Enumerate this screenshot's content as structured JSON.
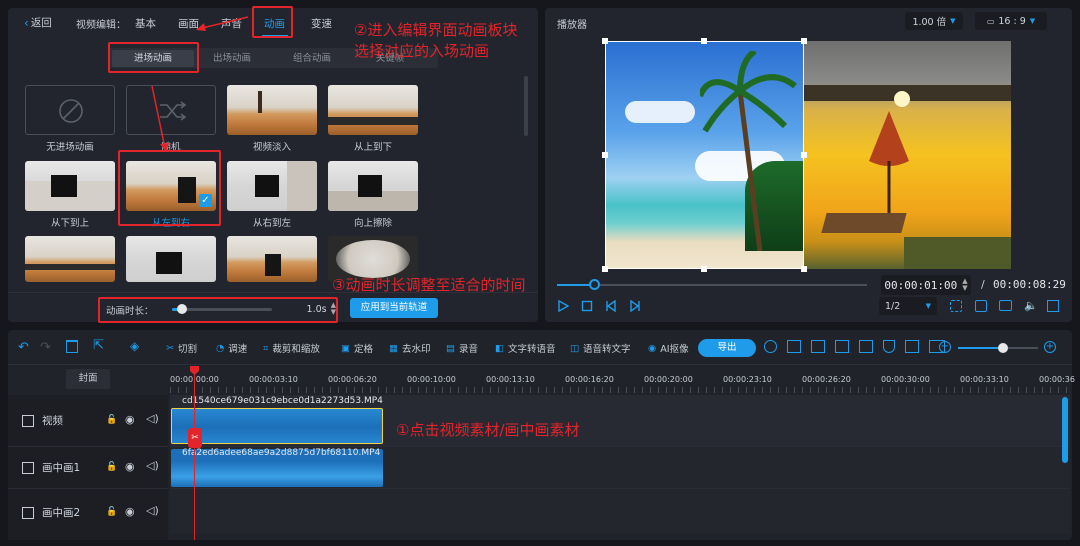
{
  "editor": {
    "back_label": "返回",
    "title_label": "视频编辑：",
    "tabs": [
      "基本",
      "画面",
      "声音",
      "动画",
      "变速"
    ],
    "subtabs": [
      "进场动画",
      "出场动画",
      "组合动画",
      "关键帧"
    ],
    "animations": [
      {
        "label": "无进场动画"
      },
      {
        "label": "随机"
      },
      {
        "label": "视频淡入"
      },
      {
        "label": "从上到下"
      },
      {
        "label": "从下到上"
      },
      {
        "label": "从左到右"
      },
      {
        "label": "从右到左"
      },
      {
        "label": "向上擦除"
      }
    ],
    "duration_label": "动画时长：",
    "duration_value": "1.0s",
    "duration_fraction": 0.1,
    "apply_button": "应用到当前轨道"
  },
  "player": {
    "title": "播放器",
    "speed": "1.00 倍",
    "ratio": "16 : 9",
    "current_time": "00:00:01:00",
    "separator": "/",
    "total_time": "00:00:08:29",
    "quality": "1/2",
    "progress_fraction": 0.12
  },
  "toolbar": {
    "items": [
      "切割",
      "调速",
      "裁剪和缩放",
      "定格",
      "去水印",
      "录音",
      "文字转语音",
      "语音转文字",
      "AI抠像"
    ],
    "export": "导出"
  },
  "timeline": {
    "cover_label": "封面",
    "ticks": [
      "00:00:00:00",
      "00:00:03:10",
      "00:00:06:20",
      "00:00:10:00",
      "00:00:13:10",
      "00:00:16:20",
      "00:00:20:00",
      "00:00:23:10",
      "00:00:26:20",
      "00:00:30:00",
      "00:00:33:10",
      "00:00:36"
    ],
    "tracks": [
      {
        "name": "视频",
        "clip": "cd1540ce679e031c9ebce0d1a2273d53.MP4"
      },
      {
        "name": "画中画1",
        "clip": "6fa2ed6adee68ae9a2d8875d7bf68110.MP4"
      },
      {
        "name": "画中画2",
        "clip": ""
      }
    ]
  },
  "annotations": {
    "a1": "①点击视频素材/画中画素材",
    "a2_line1": "②进入编辑界面动画板块",
    "a2_line2": "选择对应的入场动画",
    "a3": "③动画时长调整至适合的时间"
  },
  "colors": {
    "accent": "#1e9be9",
    "annotation": "#e3242b",
    "panel": "#22252d",
    "background": "#15171d"
  }
}
